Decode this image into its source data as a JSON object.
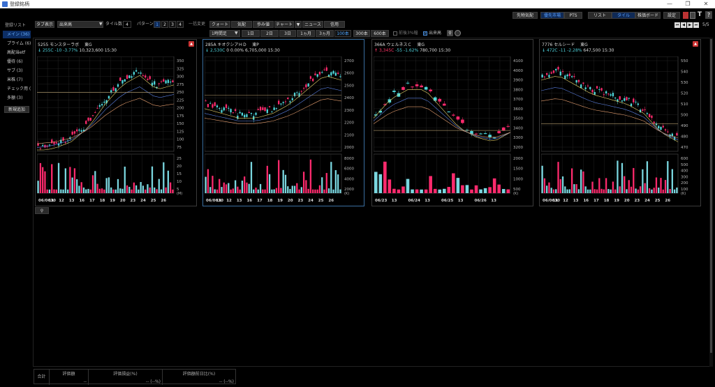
{
  "window": {
    "title": "登録銘柄",
    "minimize": "—",
    "restore": "❐",
    "close": "✕"
  },
  "toolbar_top": {
    "buttons": [
      "先物気配",
      "優先市場",
      "PTS",
      "リスト",
      "タイル",
      "株価ボード",
      "設定"
    ],
    "page": "5/5"
  },
  "toolbar": {
    "tab_display_label": "タブ表示",
    "tab_display_value": "出来高",
    "tile_count_label": "タイル数",
    "tile_count_value": "4",
    "pattern_label": "パターン",
    "patterns": [
      "1",
      "2",
      "3",
      "4"
    ],
    "bulk_change_label": "一括変更",
    "view_buttons": [
      "クォート",
      "気配",
      "歩み値",
      "チャート",
      "ニュース",
      "信用"
    ],
    "period_value": "1時間足",
    "ranges": [
      "1日",
      "2日",
      "3日",
      "1ヵ月",
      "3ヵ月"
    ],
    "bar_counts": [
      "100本",
      "300本",
      "600本"
    ],
    "check_3pct_label": "前後3%幅",
    "check_volume_label": "出来高"
  },
  "sidebar": {
    "header": "登録リスト",
    "items": [
      "メイン (36)",
      "プライム (6)",
      "高配当etf",
      "優待 (6)",
      "サブ (3)",
      "米株 (7)",
      "チェック用 (",
      "多額 (3)"
    ],
    "add_button": "新規追加"
  },
  "panels": [
    {
      "code": "5255",
      "name": "モンスターラボ",
      "market": "東G",
      "arrow": "↓",
      "price": "255",
      "flag": "C",
      "change": "-10",
      "pct": "-3.77%",
      "volume": "10,323,600",
      "time": "15:30",
      "price_ticks": [
        "350",
        "325",
        "300",
        "275",
        "250",
        "225",
        "200",
        "175",
        "150",
        "125",
        "100",
        "75"
      ],
      "vol_ticks": [
        "25",
        "20",
        "15",
        "10",
        "5"
      ],
      "vol_unit": "(M)",
      "x_labels": [
        "06/0610",
        "11",
        "12",
        "13",
        "16",
        "17",
        "18",
        "19",
        "20",
        "23",
        "24",
        "25",
        "26"
      ]
    },
    {
      "code": "285A",
      "name": "キオクシアＨＤ",
      "market": "東P",
      "arrow": "↓",
      "price": "2,530",
      "flag": "C",
      "change": "0",
      "pct": "0.00%",
      "volume": "6,705,000",
      "time": "15:30",
      "price_ticks": [
        "2700",
        "2600",
        "2500",
        "2400",
        "2300",
        "2200",
        "2100",
        "2000"
      ],
      "vol_ticks": [
        "8000",
        "6000",
        "4000",
        "2000"
      ],
      "vol_unit": "(K)",
      "x_labels": [
        "06/0610",
        "11",
        "12",
        "13",
        "16",
        "17",
        "18",
        "19",
        "20",
        "23",
        "24",
        "25",
        "26"
      ]
    },
    {
      "code": "366A",
      "name": "ウェルネスＣ",
      "market": "東G",
      "arrow": "↑",
      "price": "3,345",
      "flag": "C",
      "change": "-55",
      "pct": "-1.62%",
      "volume": "780,700",
      "time": "15:30",
      "price_ticks": [
        "4100",
        "4000",
        "3900",
        "3800",
        "3700",
        "3600",
        "3500",
        "3400",
        "3300",
        "3200"
      ],
      "vol_ticks": [
        "2000",
        "1500",
        "1000",
        "500"
      ],
      "vol_unit": "(K)",
      "x_labels": [
        "06/23",
        "13",
        "06/24",
        "13",
        "06/25",
        "13",
        "06/26",
        "13"
      ]
    },
    {
      "code": "7776",
      "name": "セルシード",
      "market": "東G",
      "arrow": "↓",
      "price": "472",
      "flag": "C",
      "change": "-11",
      "pct": "-2.28%",
      "volume": "647,500",
      "time": "15:30",
      "price_ticks": [
        "550",
        "540",
        "530",
        "520",
        "510",
        "500",
        "490",
        "480",
        "470"
      ],
      "vol_ticks": [
        "600",
        "500",
        "400",
        "300",
        "200",
        "100"
      ],
      "vol_unit": "(K)",
      "x_labels": [
        "06/0610",
        "11",
        "12",
        "13",
        "16",
        "17",
        "18",
        "19",
        "20",
        "23",
        "24",
        "25",
        "26"
      ]
    }
  ],
  "summary": {
    "total_label": "合計",
    "headers": [
      "評価額",
      "評価損益(%)",
      "評価額前日比(%)"
    ],
    "values": [
      "--",
      "-- (--%)",
      "-- (--%)"
    ]
  },
  "colors": {
    "up": "#ff2a6d",
    "down": "#4fd8dc",
    "accent": "#2f6fd6",
    "bg": "#000000"
  }
}
